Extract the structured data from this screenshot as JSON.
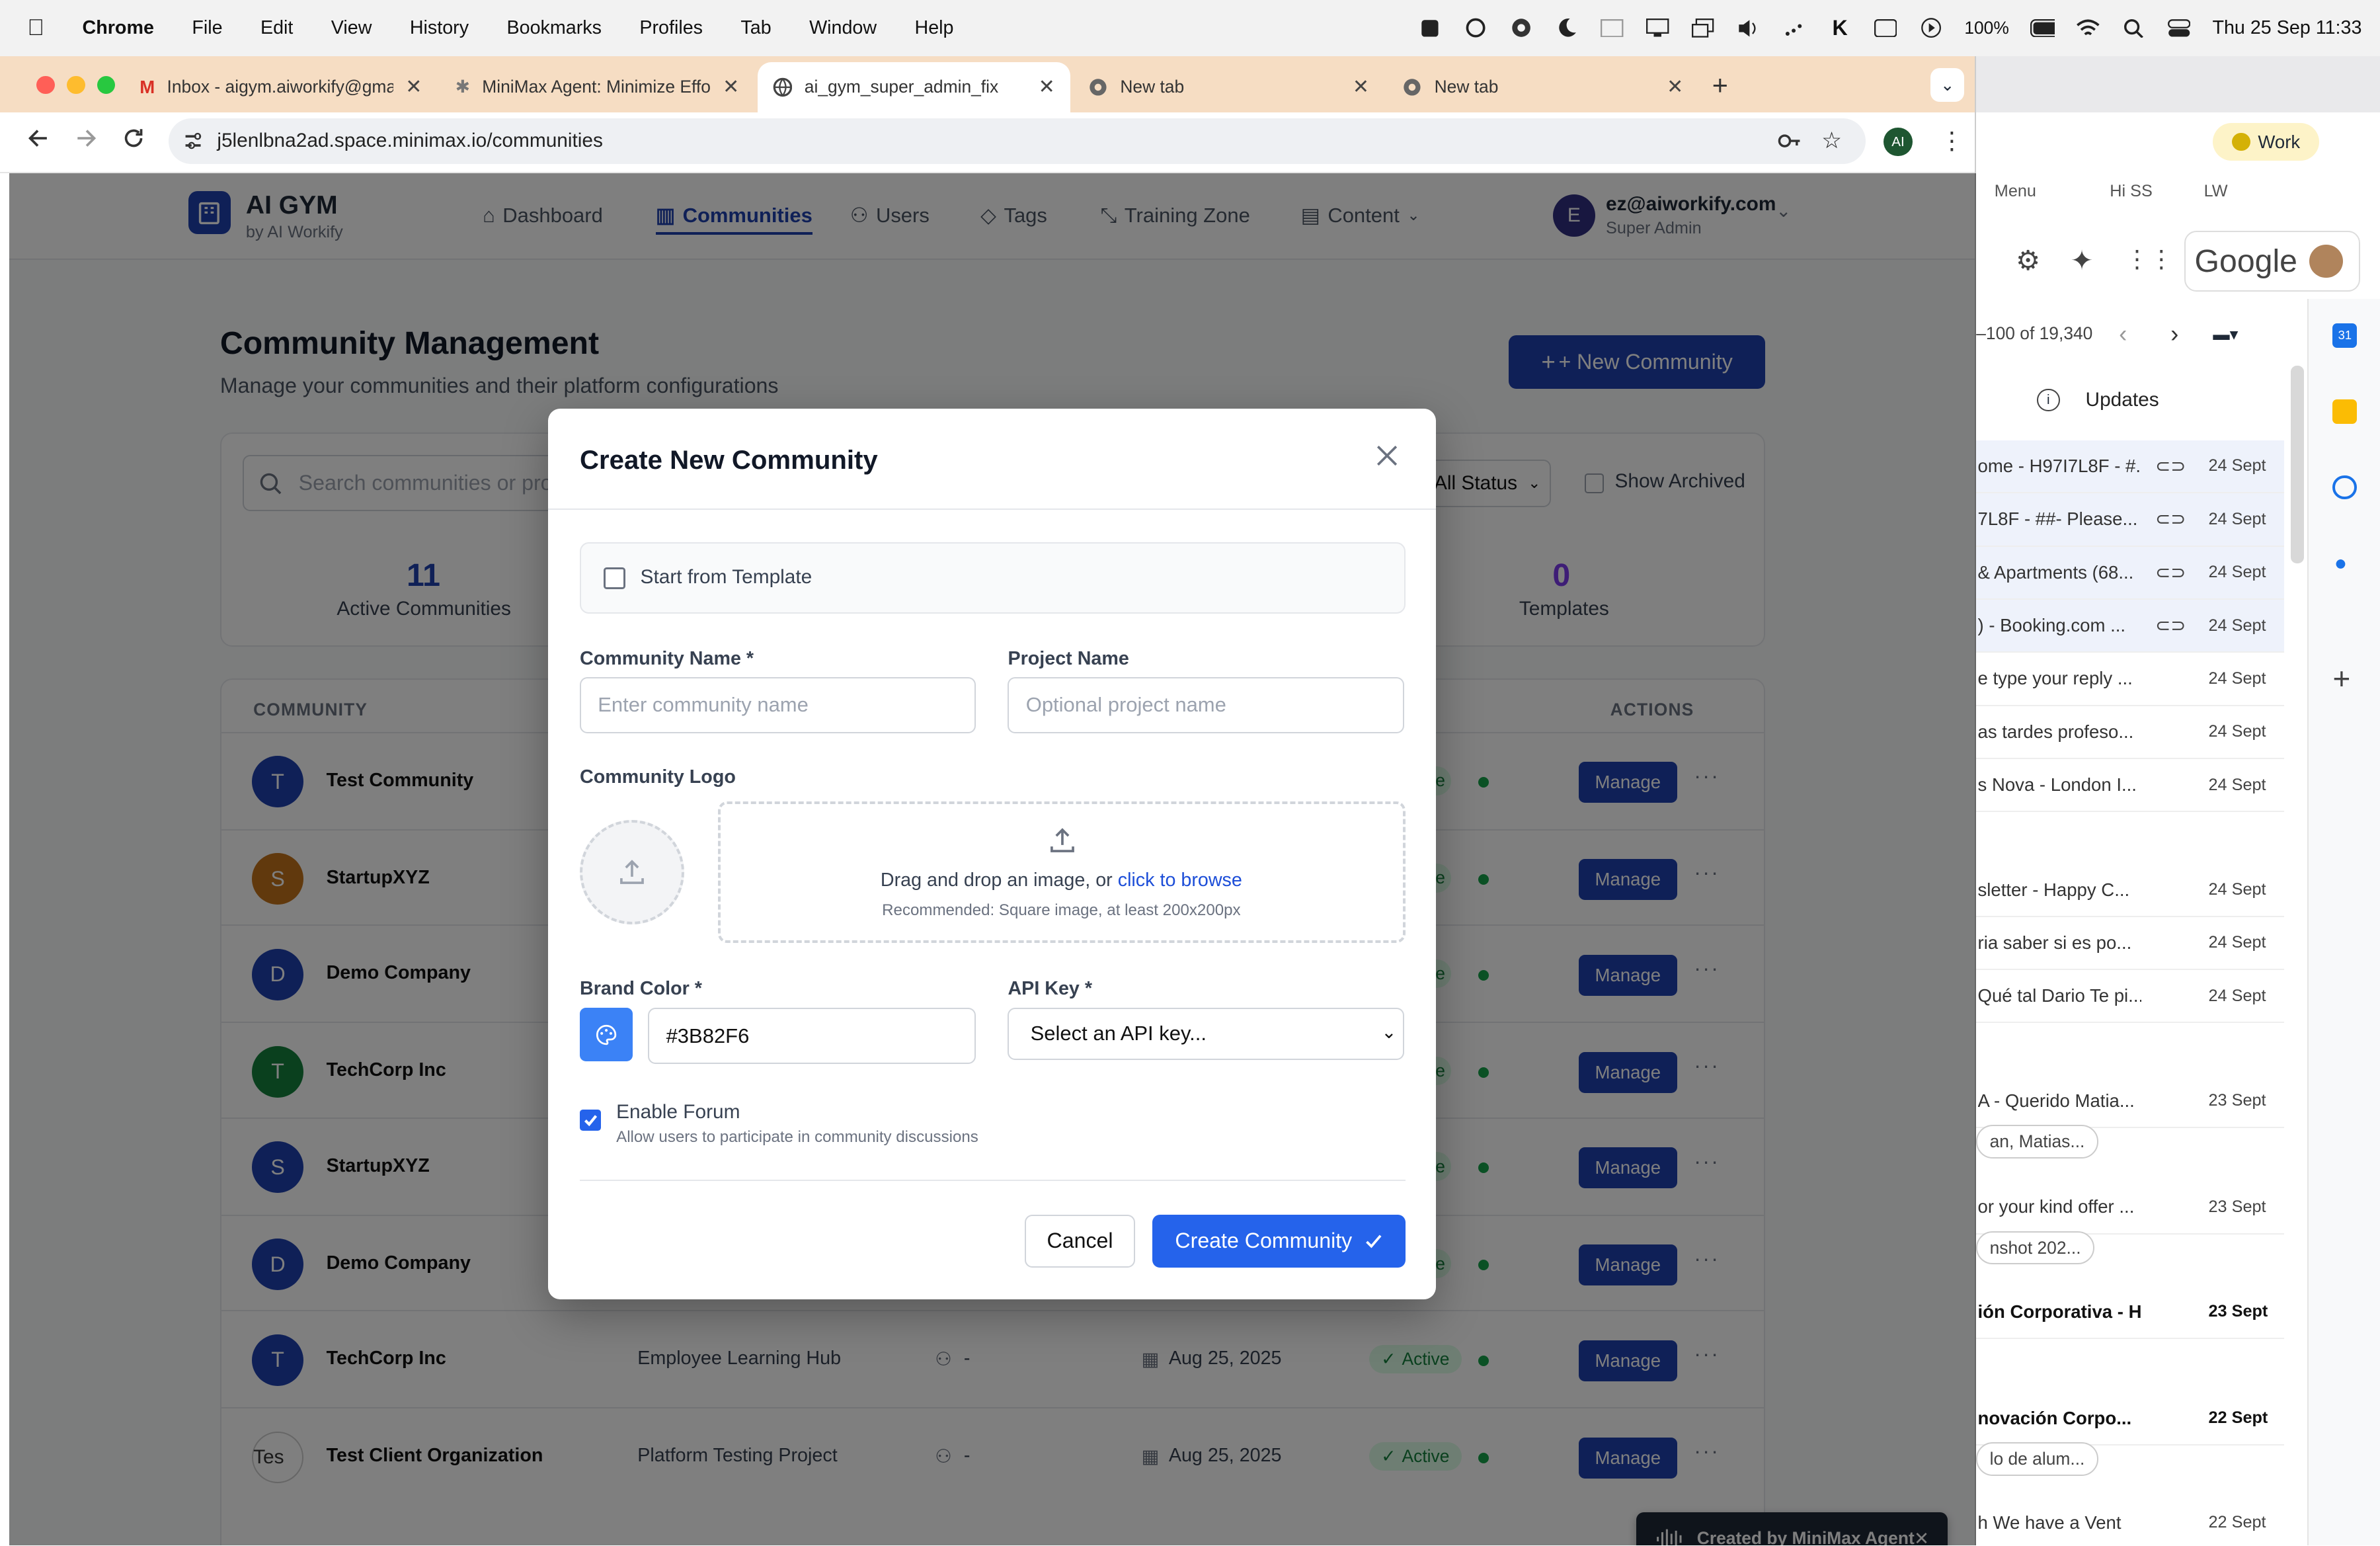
{
  "menubar": {
    "app": "Chrome",
    "items": [
      "File",
      "Edit",
      "View",
      "History",
      "Bookmarks",
      "Profiles",
      "Tab",
      "Window",
      "Help"
    ],
    "battery": "100%",
    "datetime": "Thu 25 Sep  11:33"
  },
  "browser": {
    "tabs": [
      {
        "title": "Inbox - aigym.aiworkify@gma",
        "icon": "gmail-icon"
      },
      {
        "title": "MiniMax Agent: Minimize Effo",
        "icon": "minimax-icon"
      },
      {
        "title": "ai_gym_super_admin_fix",
        "icon": "globe-icon",
        "active": true
      },
      {
        "title": "New tab",
        "icon": "chrome-icon"
      },
      {
        "title": "New tab",
        "icon": "chrome-icon"
      }
    ],
    "url": "j5lenlbna2ad.space.minimax.io/communities",
    "profile_initials": "AI"
  },
  "app": {
    "brand": "AI GYM",
    "brand_sub": "by AI Workify",
    "nav": [
      "Dashboard",
      "Communities",
      "Users",
      "Tags",
      "Training Zone",
      "Content"
    ],
    "user_email": "ez@aiworkify.com",
    "user_role": "Super Admin",
    "user_initial": "E"
  },
  "page": {
    "title": "Community Management",
    "subtitle": "Manage your communities and their platform configurations",
    "new_button": "+ New Community",
    "search_placeholder": "Search communities or pro",
    "status_filter": "All Status",
    "show_archived": "Show Archived",
    "stats": [
      {
        "value": "11",
        "label": "Active Communities"
      },
      {
        "value": "0",
        "label": "Templates"
      }
    ],
    "col_community": "COMMUNITY",
    "col_actions": "ACTIONS",
    "rows": [
      {
        "initial": "T",
        "name": "Test Community",
        "color": "#1e40af"
      },
      {
        "initial": "S",
        "name": "StartupXYZ",
        "color": "#c2721a"
      },
      {
        "initial": "D",
        "name": "Demo Company",
        "color": "#1e40af"
      },
      {
        "initial": "T",
        "name": "TechCorp Inc",
        "color": "#15803d"
      },
      {
        "initial": "S",
        "name": "StartupXYZ",
        "color": "#1e40af"
      },
      {
        "initial": "D",
        "name": "Demo Company",
        "color": "#1e40af"
      },
      {
        "initial": "T",
        "name": "TechCorp Inc",
        "color": "#1e40af",
        "project": "Employee Learning Hub",
        "members": "-",
        "date": "Aug 25, 2025",
        "status": "Active"
      },
      {
        "initial": "Tes",
        "name": "Test Client Organization",
        "color": "#ffffff",
        "project": "Platform Testing Project",
        "members": "-",
        "date": "Aug 25, 2025",
        "status": "Active"
      }
    ],
    "manage_label": "Manage",
    "active_fragment": "ve"
  },
  "modal": {
    "title": "Create New Community",
    "template_label": "Start from Template",
    "name_label": "Community Name *",
    "name_placeholder": "Enter community name",
    "project_label": "Project Name",
    "project_placeholder": "Optional project name",
    "logo_label": "Community Logo",
    "drop_text": "Drag and drop an image, or ",
    "browse_link": "click to browse",
    "drop_hint": "Recommended: Square image, at least 200x200px",
    "brand_label": "Brand Color *",
    "brand_value": "#3B82F6",
    "api_label": "API Key *",
    "api_value": "Select an API key...",
    "forum_label": "Enable Forum",
    "forum_hint": "Allow users to participate in community discussions",
    "forum_checked": true,
    "cancel": "Cancel",
    "create": "Create Community"
  },
  "toast": "Created by MiniMax Agent",
  "sidepanel": {
    "bookmarks": [
      "Menu",
      "Hi SS",
      "LW"
    ],
    "google_logo": "Google",
    "pager": "–100 of 19,340",
    "updates": "Updates",
    "mails": [
      {
        "text": "ome - H97I7L8F - #.",
        "date": "24 Sept",
        "clip": true
      },
      {
        "text": "7L8F - ##- Please...",
        "date": "24 Sept",
        "clip": true
      },
      {
        "text": "& Apartments (68...",
        "date": "24 Sept",
        "clip": true
      },
      {
        "text": ") - Booking.com ...",
        "date": "24 Sept",
        "clip": true
      },
      {
        "text": "e type your reply ...",
        "date": "24 Sept"
      },
      {
        "text": "as tardes profeso...",
        "date": "24 Sept"
      },
      {
        "text": "s Nova - London I...",
        "date": "24 Sept"
      },
      {
        "text": "sletter - Happy C...",
        "date": "24 Sept"
      },
      {
        "text": "ria saber si es po...",
        "date": "24 Sept"
      },
      {
        "text": "Qué tal Dario Te pi...",
        "date": "24 Sept"
      },
      {
        "text": "A - Querido Matia...",
        "date": "23 Sept"
      },
      {
        "text": "or your kind offer ...",
        "date": "23 Sept"
      },
      {
        "text": "ión Corporativa - H",
        "date": "23 Sept",
        "bold": true
      },
      {
        "text": "novación Corpo...",
        "date": "22 Sept",
        "bold": true
      },
      {
        "text": "h We have a Vent",
        "date": "22 Sept"
      }
    ],
    "chips": [
      "an, Matias...",
      "nshot 202...",
      "lo de alum..."
    ],
    "work_profile": "Work"
  }
}
